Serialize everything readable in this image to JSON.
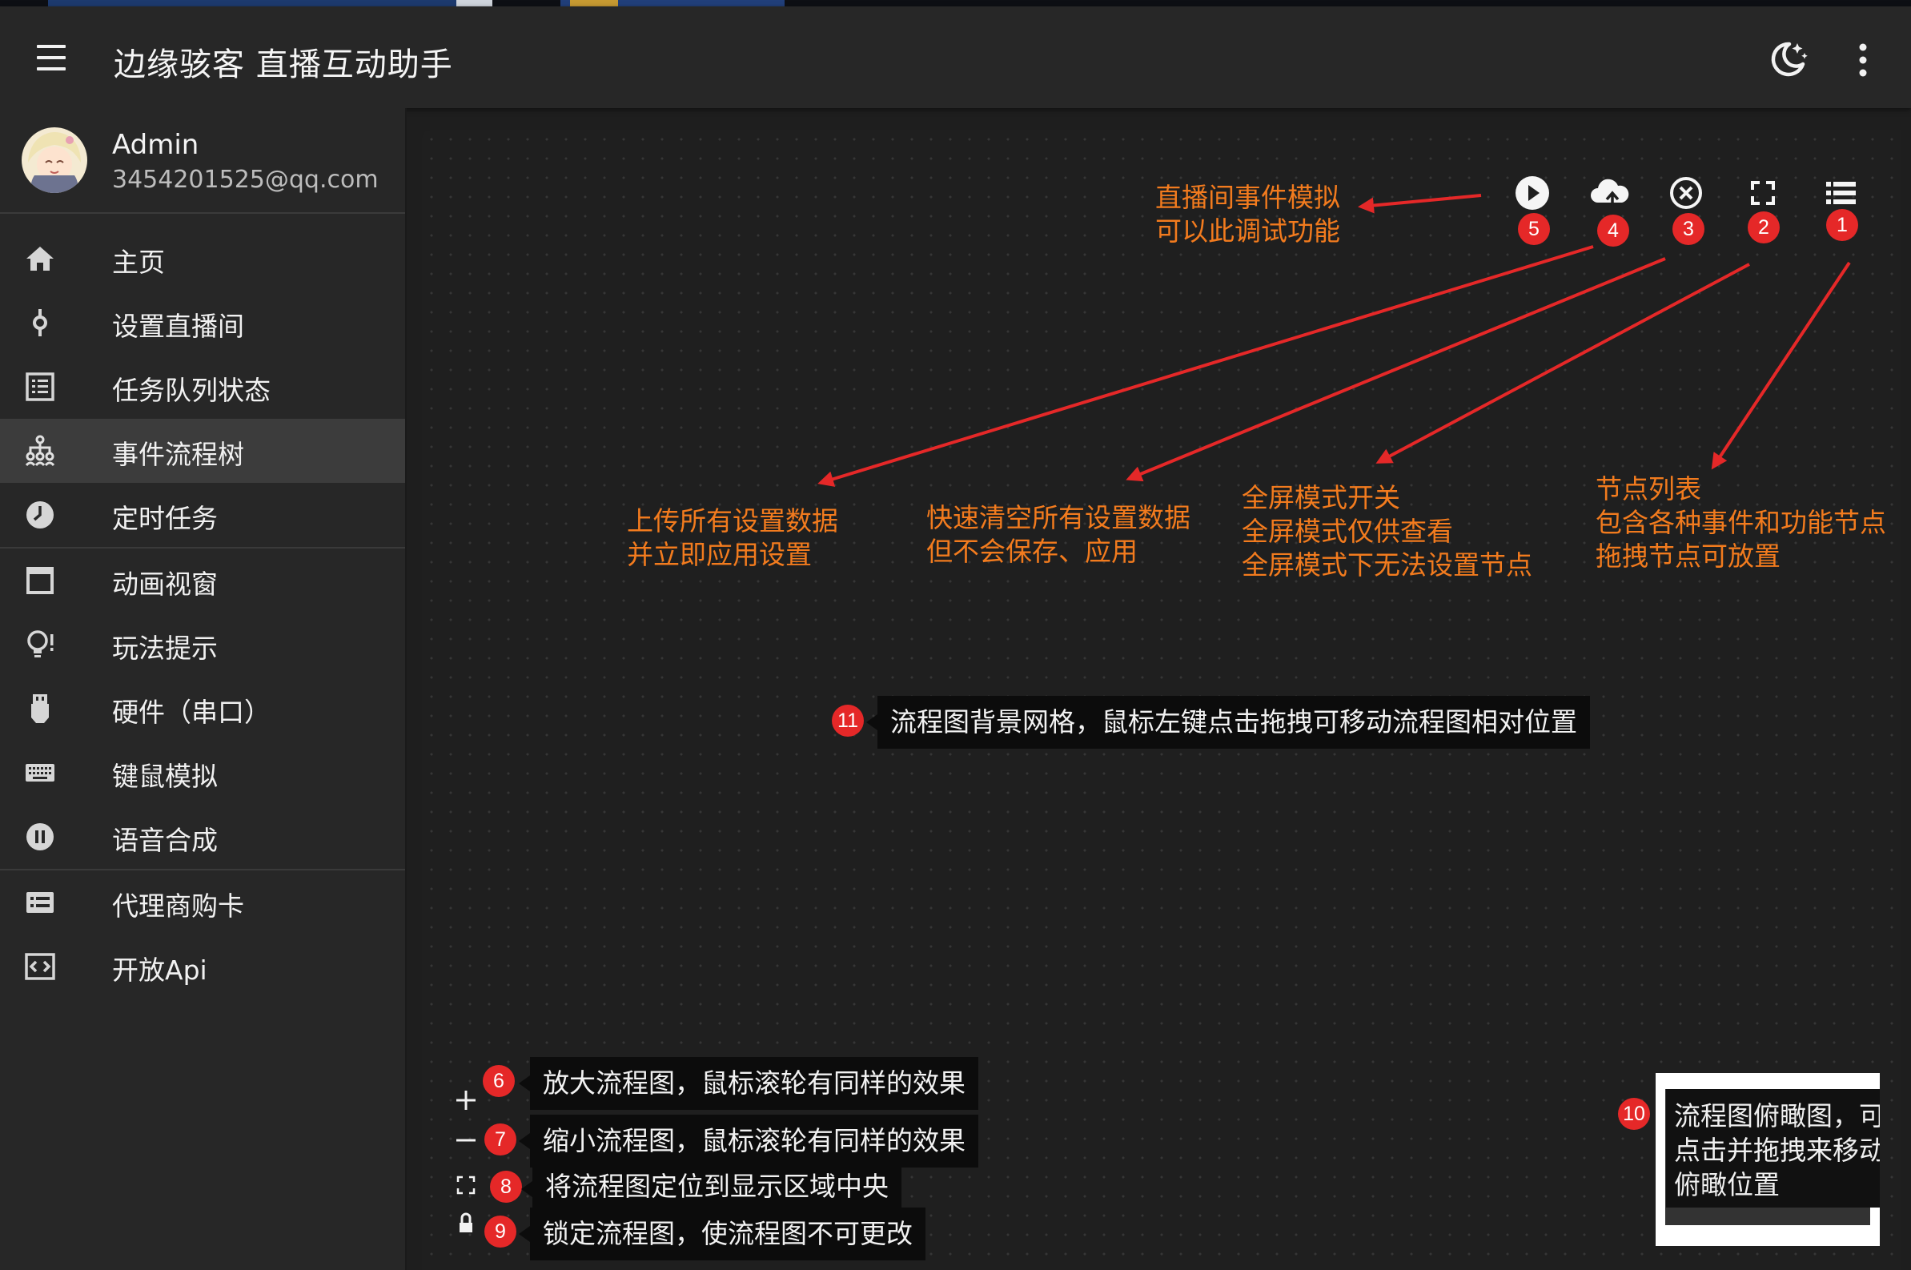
{
  "app": {
    "title": "边缘骇客 直播互动助手",
    "accent_color": "#e52828",
    "annotation_color": "#f27b1e"
  },
  "header": {
    "menu_icon": "hamburger-menu-icon",
    "theme_icon": "moon-theme-icon",
    "more_icon": "more-vertical-icon"
  },
  "profile": {
    "name": "Admin",
    "email": "3454201525@qq.com"
  },
  "sidebar": {
    "items": [
      {
        "label": "主页",
        "icon": "home-icon",
        "active": false
      },
      {
        "label": "设置直播间",
        "icon": "pin-icon",
        "active": false
      },
      {
        "label": "任务队列状态",
        "icon": "list-icon",
        "active": false
      },
      {
        "label": "事件流程树",
        "icon": "tree-icon",
        "active": true
      },
      {
        "label": "定时任务",
        "icon": "clock-icon",
        "active": false
      },
      {
        "label": "动画视窗",
        "icon": "window-icon",
        "active": false
      },
      {
        "label": "玩法提示",
        "icon": "lightbulb-icon",
        "active": false
      },
      {
        "label": "硬件（串口）",
        "icon": "usb-icon",
        "active": false
      },
      {
        "label": "键鼠模拟",
        "icon": "keyboard-icon",
        "active": false
      },
      {
        "label": "语音合成",
        "icon": "pause-circle-icon",
        "active": false
      },
      {
        "label": "代理商购卡",
        "icon": "card-icon",
        "active": false
      },
      {
        "label": "开放Api",
        "icon": "code-icon",
        "active": false
      }
    ]
  },
  "toolbar": {
    "buttons": [
      {
        "badge": "5",
        "icon": "play-circle-icon"
      },
      {
        "badge": "4",
        "icon": "cloud-upload-icon"
      },
      {
        "badge": "3",
        "icon": "close-circle-icon"
      },
      {
        "badge": "2",
        "icon": "fullscreen-icon"
      },
      {
        "badge": "1",
        "icon": "node-list-icon"
      }
    ]
  },
  "annotations": {
    "simulate": {
      "line1": "直播间事件模拟",
      "line2": "可以此调试功能"
    },
    "upload": {
      "line1": "上传所有设置数据",
      "line2": "并立即应用设置"
    },
    "clear": {
      "line1": "快速清空所有设置数据",
      "line2": "但不会保存、应用"
    },
    "fullscreen": {
      "line1": "全屏模式开关",
      "line2": "全屏模式仅供查看",
      "line3": "全屏模式下无法设置节点"
    },
    "nodelist": {
      "line1": "节点列表",
      "line2": "包含各种事件和功能节点",
      "line3": "拖拽节点可放置"
    }
  },
  "grid_tip": {
    "badge": "11",
    "text": "流程图背景网格，鼠标左键点击拖拽可移动流程图相对位置"
  },
  "zoom_controls": [
    {
      "badge": "6",
      "icon": "plus-icon",
      "text": "放大流程图，鼠标滚轮有同样的效果"
    },
    {
      "badge": "7",
      "icon": "minus-icon",
      "text": "缩小流程图，鼠标滚轮有同样的效果"
    },
    {
      "badge": "8",
      "icon": "fit-view-icon",
      "text": "将流程图定位到显示区域中央"
    },
    {
      "badge": "9",
      "icon": "lock-icon",
      "text": "锁定流程图，使流程图不可更改"
    }
  ],
  "minimap_tip": {
    "badge": "10",
    "line1": "流程图俯瞰图，可",
    "line2": "点击并拖拽来移动",
    "line3": "俯瞰位置"
  }
}
